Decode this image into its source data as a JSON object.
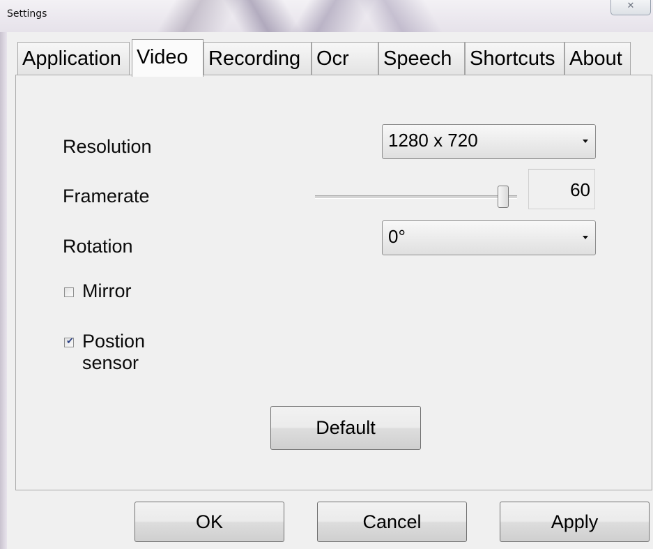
{
  "window": {
    "title": "Settings",
    "close_glyph": "✕"
  },
  "tabs": [
    {
      "label": "Application",
      "active": false
    },
    {
      "label": "Video",
      "active": true
    },
    {
      "label": "Recording",
      "active": false
    },
    {
      "label": "Ocr",
      "active": false
    },
    {
      "label": "Speech",
      "active": false
    },
    {
      "label": "Shortcuts",
      "active": false
    },
    {
      "label": "About",
      "active": false
    }
  ],
  "video": {
    "resolution": {
      "label": "Resolution",
      "value": "1280 x 720"
    },
    "framerate": {
      "label": "Framerate",
      "value": "60",
      "slider_fraction": 0.93
    },
    "rotation": {
      "label": "Rotation",
      "value": "0°"
    },
    "mirror": {
      "label": "Mirror",
      "checked": false
    },
    "position_sensor": {
      "label": "Postion sensor",
      "checked": true
    },
    "default_button": "Default"
  },
  "footer": {
    "ok": "OK",
    "cancel": "Cancel",
    "apply": "Apply"
  },
  "icons": {
    "dropdown": "chevron-down-icon",
    "checkmark": "check-icon"
  }
}
